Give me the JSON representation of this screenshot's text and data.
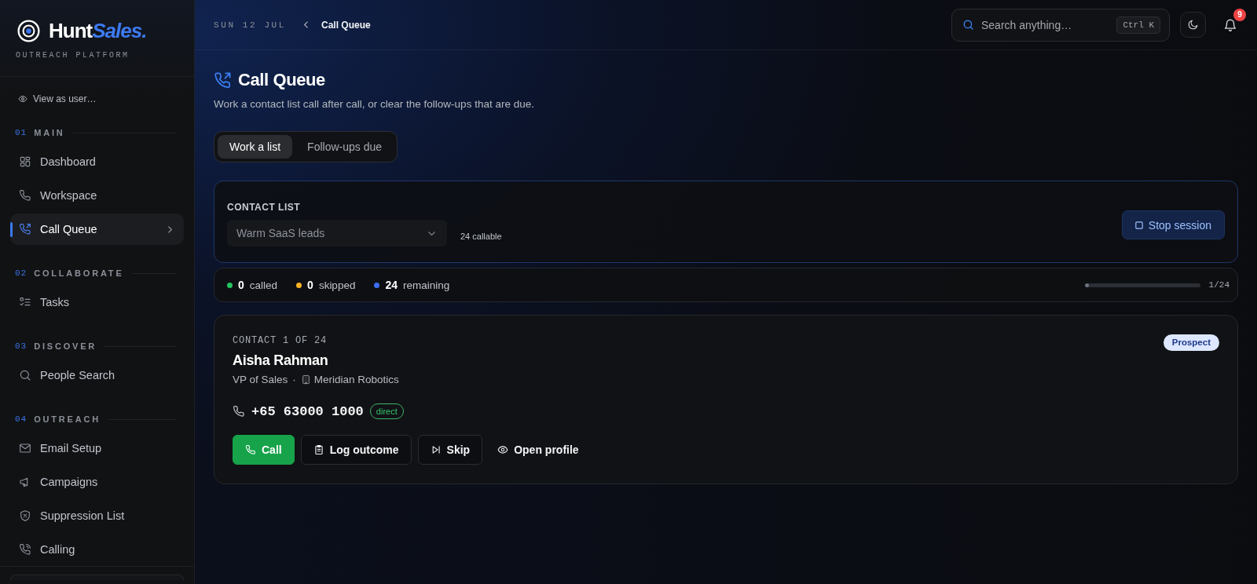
{
  "sidebar": {
    "logo": {
      "primary": "Hunt",
      "accent": "Sales."
    },
    "tagline": "OUTREACH PLATFORM",
    "view_as": "View as user…",
    "sections": [
      {
        "number": "01",
        "title": "MAIN",
        "items": [
          {
            "label": "Dashboard",
            "selected": false
          },
          {
            "label": "Workspace",
            "selected": false
          },
          {
            "label": "Call Queue",
            "selected": true
          }
        ]
      },
      {
        "number": "02",
        "title": "COLLABORATE",
        "items": [
          {
            "label": "Tasks",
            "selected": false
          }
        ]
      },
      {
        "number": "03",
        "title": "DISCOVER",
        "items": [
          {
            "label": "People Search",
            "selected": false
          }
        ]
      },
      {
        "number": "04",
        "title": "OUTREACH",
        "items": [
          {
            "label": "Email Setup",
            "selected": false
          },
          {
            "label": "Campaigns",
            "selected": false
          },
          {
            "label": "Suppression List",
            "selected": false
          },
          {
            "label": "Calling",
            "selected": false
          }
        ]
      }
    ]
  },
  "header": {
    "date": "SUN 12 JUL",
    "breadcrumb": "Call Queue",
    "search": {
      "placeholder": "Search anything…",
      "shortcut": "Ctrl K"
    },
    "notifications": "9"
  },
  "page": {
    "title": "Call Queue",
    "subtitle": "Work a contact list call after call, or clear the follow-ups that are due."
  },
  "tabs": [
    {
      "label": "Work a list",
      "selected": true
    },
    {
      "label": "Follow-ups due",
      "selected": false
    }
  ],
  "contact_list": {
    "label": "CONTACT LIST",
    "select": {
      "value": "Warm SaaS leads"
    },
    "count": "24 callable",
    "stop_button": "Stop session"
  },
  "progress": {
    "stats": [
      {
        "value": "0",
        "label": "called",
        "color": "#22c55e"
      },
      {
        "value": "0",
        "label": "skipped",
        "color": "#f5b323"
      },
      {
        "value": "24",
        "label": "remaining",
        "color": "#3b6ff5"
      }
    ],
    "level": 0.04,
    "position": "1/24"
  },
  "contact": {
    "position": "CONTACT 1 OF 24",
    "name": "Aisha Rahman",
    "title": "VP of Sales",
    "separator": "·",
    "company": "Meridian Robotics",
    "phone": "+65 63000 1000",
    "phone_type": "direct",
    "status": "Prospect",
    "actions": [
      {
        "label": "Call",
        "kind": "primary"
      },
      {
        "label": "Log outcome",
        "kind": "outline"
      },
      {
        "label": "Skip",
        "kind": "outline"
      },
      {
        "label": "Open profile",
        "kind": "ghost"
      }
    ]
  }
}
